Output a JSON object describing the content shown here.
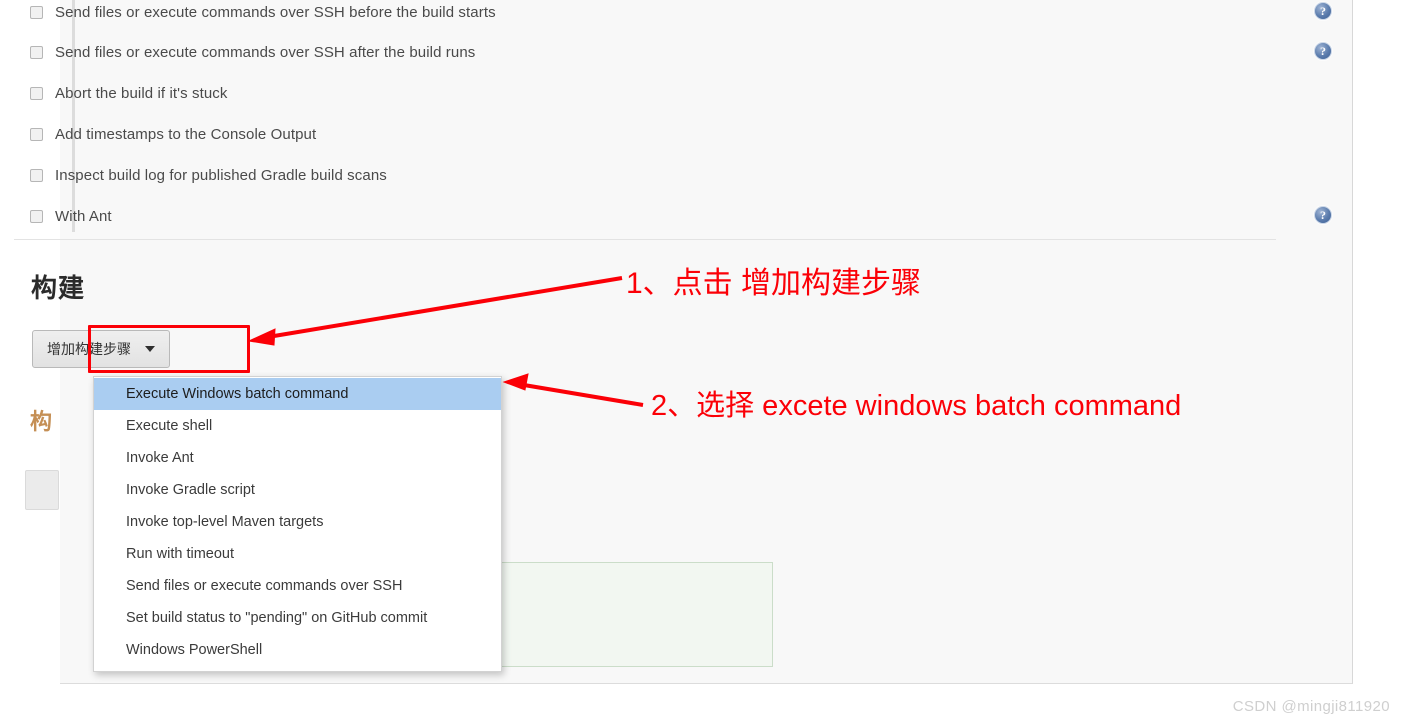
{
  "page": {
    "section_heading": "构建",
    "watermark": "CSDN @mingji811920"
  },
  "colors": {
    "annotation_red": "#fb0007",
    "dropdown_selected": "#aacdf1",
    "panel_bg": "#f8f8f8",
    "help_icon_blue": "#3c5f94"
  },
  "checkbox_options": [
    {
      "label": "Send files or execute commands over SSH before the build starts",
      "checked": false,
      "has_help": true
    },
    {
      "label": "Send files or execute commands over SSH after the build runs",
      "checked": false,
      "has_help": true
    },
    {
      "label": "Abort the build if it's stuck",
      "checked": false,
      "has_help": false
    },
    {
      "label": "Add timestamps to the Console Output",
      "checked": false,
      "has_help": false
    },
    {
      "label": "Inspect build log for published Gradle build scans",
      "checked": false,
      "has_help": false
    },
    {
      "label": "With Ant",
      "checked": false,
      "has_help": true
    }
  ],
  "add_step_button": {
    "label": "增加构建步骤",
    "caret_icon": "chevron-down-icon"
  },
  "dropdown": {
    "selected": "Execute Windows batch command",
    "items": [
      "Execute Windows batch command",
      "Execute shell",
      "Invoke Ant",
      "Invoke Gradle script",
      "Invoke top-level Maven targets",
      "Run with timeout",
      "Send files or execute commands over SSH",
      "Set build status to \"pending\" on GitHub commit",
      "Windows PowerShell"
    ]
  },
  "annotations": [
    {
      "id": "step-1",
      "text": "1、点击 增加构建步骤"
    },
    {
      "id": "step-2",
      "text": "2、选择 excete windows batch command"
    }
  ],
  "behind": {
    "partial_heading": "构",
    "help_glyph": "?"
  }
}
